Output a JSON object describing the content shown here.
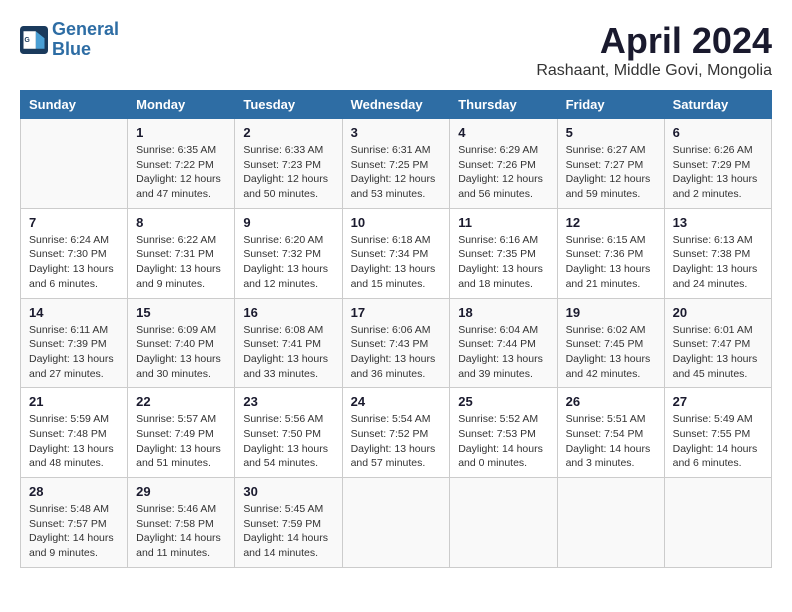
{
  "logo": {
    "line1": "General",
    "line2": "Blue"
  },
  "title": "April 2024",
  "subtitle": "Rashaant, Middle Govi, Mongolia",
  "header_days": [
    "Sunday",
    "Monday",
    "Tuesday",
    "Wednesday",
    "Thursday",
    "Friday",
    "Saturday"
  ],
  "weeks": [
    [
      {
        "num": "",
        "info": ""
      },
      {
        "num": "1",
        "info": "Sunrise: 6:35 AM\nSunset: 7:22 PM\nDaylight: 12 hours\nand 47 minutes."
      },
      {
        "num": "2",
        "info": "Sunrise: 6:33 AM\nSunset: 7:23 PM\nDaylight: 12 hours\nand 50 minutes."
      },
      {
        "num": "3",
        "info": "Sunrise: 6:31 AM\nSunset: 7:25 PM\nDaylight: 12 hours\nand 53 minutes."
      },
      {
        "num": "4",
        "info": "Sunrise: 6:29 AM\nSunset: 7:26 PM\nDaylight: 12 hours\nand 56 minutes."
      },
      {
        "num": "5",
        "info": "Sunrise: 6:27 AM\nSunset: 7:27 PM\nDaylight: 12 hours\nand 59 minutes."
      },
      {
        "num": "6",
        "info": "Sunrise: 6:26 AM\nSunset: 7:29 PM\nDaylight: 13 hours\nand 2 minutes."
      }
    ],
    [
      {
        "num": "7",
        "info": "Sunrise: 6:24 AM\nSunset: 7:30 PM\nDaylight: 13 hours\nand 6 minutes."
      },
      {
        "num": "8",
        "info": "Sunrise: 6:22 AM\nSunset: 7:31 PM\nDaylight: 13 hours\nand 9 minutes."
      },
      {
        "num": "9",
        "info": "Sunrise: 6:20 AM\nSunset: 7:32 PM\nDaylight: 13 hours\nand 12 minutes."
      },
      {
        "num": "10",
        "info": "Sunrise: 6:18 AM\nSunset: 7:34 PM\nDaylight: 13 hours\nand 15 minutes."
      },
      {
        "num": "11",
        "info": "Sunrise: 6:16 AM\nSunset: 7:35 PM\nDaylight: 13 hours\nand 18 minutes."
      },
      {
        "num": "12",
        "info": "Sunrise: 6:15 AM\nSunset: 7:36 PM\nDaylight: 13 hours\nand 21 minutes."
      },
      {
        "num": "13",
        "info": "Sunrise: 6:13 AM\nSunset: 7:38 PM\nDaylight: 13 hours\nand 24 minutes."
      }
    ],
    [
      {
        "num": "14",
        "info": "Sunrise: 6:11 AM\nSunset: 7:39 PM\nDaylight: 13 hours\nand 27 minutes."
      },
      {
        "num": "15",
        "info": "Sunrise: 6:09 AM\nSunset: 7:40 PM\nDaylight: 13 hours\nand 30 minutes."
      },
      {
        "num": "16",
        "info": "Sunrise: 6:08 AM\nSunset: 7:41 PM\nDaylight: 13 hours\nand 33 minutes."
      },
      {
        "num": "17",
        "info": "Sunrise: 6:06 AM\nSunset: 7:43 PM\nDaylight: 13 hours\nand 36 minutes."
      },
      {
        "num": "18",
        "info": "Sunrise: 6:04 AM\nSunset: 7:44 PM\nDaylight: 13 hours\nand 39 minutes."
      },
      {
        "num": "19",
        "info": "Sunrise: 6:02 AM\nSunset: 7:45 PM\nDaylight: 13 hours\nand 42 minutes."
      },
      {
        "num": "20",
        "info": "Sunrise: 6:01 AM\nSunset: 7:47 PM\nDaylight: 13 hours\nand 45 minutes."
      }
    ],
    [
      {
        "num": "21",
        "info": "Sunrise: 5:59 AM\nSunset: 7:48 PM\nDaylight: 13 hours\nand 48 minutes."
      },
      {
        "num": "22",
        "info": "Sunrise: 5:57 AM\nSunset: 7:49 PM\nDaylight: 13 hours\nand 51 minutes."
      },
      {
        "num": "23",
        "info": "Sunrise: 5:56 AM\nSunset: 7:50 PM\nDaylight: 13 hours\nand 54 minutes."
      },
      {
        "num": "24",
        "info": "Sunrise: 5:54 AM\nSunset: 7:52 PM\nDaylight: 13 hours\nand 57 minutes."
      },
      {
        "num": "25",
        "info": "Sunrise: 5:52 AM\nSunset: 7:53 PM\nDaylight: 14 hours\nand 0 minutes."
      },
      {
        "num": "26",
        "info": "Sunrise: 5:51 AM\nSunset: 7:54 PM\nDaylight: 14 hours\nand 3 minutes."
      },
      {
        "num": "27",
        "info": "Sunrise: 5:49 AM\nSunset: 7:55 PM\nDaylight: 14 hours\nand 6 minutes."
      }
    ],
    [
      {
        "num": "28",
        "info": "Sunrise: 5:48 AM\nSunset: 7:57 PM\nDaylight: 14 hours\nand 9 minutes."
      },
      {
        "num": "29",
        "info": "Sunrise: 5:46 AM\nSunset: 7:58 PM\nDaylight: 14 hours\nand 11 minutes."
      },
      {
        "num": "30",
        "info": "Sunrise: 5:45 AM\nSunset: 7:59 PM\nDaylight: 14 hours\nand 14 minutes."
      },
      {
        "num": "",
        "info": ""
      },
      {
        "num": "",
        "info": ""
      },
      {
        "num": "",
        "info": ""
      },
      {
        "num": "",
        "info": ""
      }
    ]
  ]
}
